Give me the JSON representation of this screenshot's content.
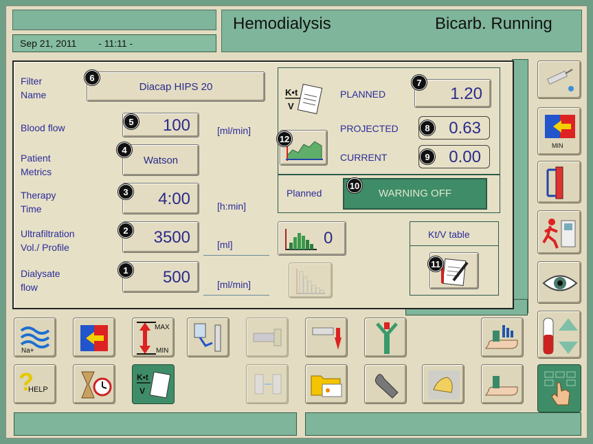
{
  "header": {
    "date": "Sep 21, 2011",
    "time": "- 11:11 -",
    "mode_title": "Hemodialysis",
    "status": "Bicarb. Running"
  },
  "params": {
    "filter_label": "Filter\nName",
    "filter_value": "Diacap HIPS 20",
    "filter_badge": "6",
    "blood_flow_label": "Blood flow",
    "blood_flow_value": "100",
    "blood_flow_unit": "[ml/min]",
    "blood_flow_badge": "5",
    "patient_label": "Patient\nMetrics",
    "patient_value": "Watson",
    "patient_badge": "4",
    "therapy_label": "Therapy\nTime",
    "therapy_value": "4:00",
    "therapy_unit": "[h:min]",
    "therapy_badge": "3",
    "uf_label": "Ultrafiltration\nVol./ Profile",
    "uf_value": "3500",
    "uf_unit": "[ml]",
    "uf_badge": "2",
    "uf_profile_value": "0",
    "dialysate_label": "Dialysate\nflow",
    "dialysate_value": "500",
    "dialysate_unit": "[ml/min]",
    "dialysate_badge": "1"
  },
  "ktv": {
    "planned_label": "PLANNED",
    "planned_value": "1.20",
    "planned_badge": "7",
    "projected_label": "PROJECTED",
    "projected_value": "0.63",
    "projected_badge": "8",
    "current_label": "CURRENT",
    "current_value": "0.00",
    "current_badge": "9",
    "graph_badge": "12",
    "planned_row_label": "Planned",
    "warning_value": "WARNING OFF",
    "warning_badge": "10",
    "table_label": "Kt/V table",
    "table_badge": "11",
    "icon_text_top": "K•t",
    "icon_text_bottom": "V"
  },
  "side_buttons": {
    "min_label": "MIN"
  },
  "toolbar": {
    "na_label": "Na+",
    "max_label": "MAX",
    "min_label": "MIN",
    "help_label": "HELP",
    "ktv_top": "K•t",
    "ktv_bottom": "V"
  },
  "colors": {
    "accent_green": "#7fb59a",
    "panel_beige": "#e6e0c6",
    "text_blue": "#2b2b9a",
    "selected_green": "#3f8d68"
  }
}
